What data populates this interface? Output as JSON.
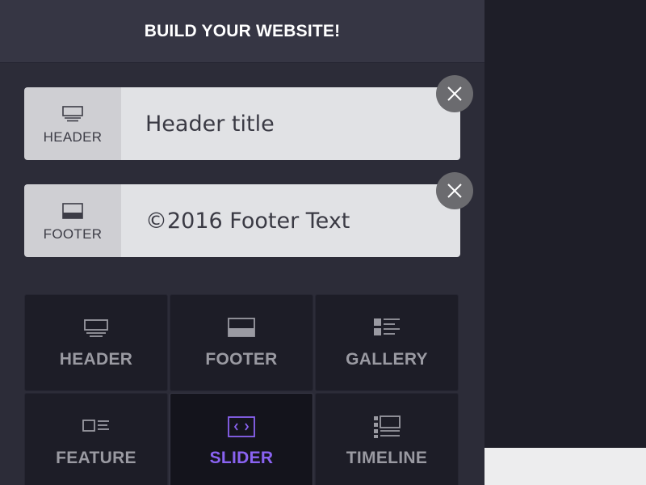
{
  "panel": {
    "title": "BUILD YOUR WEBSITE!"
  },
  "blocks": [
    {
      "tag": "HEADER",
      "icon": "header-icon",
      "value": "Header title"
    },
    {
      "tag": "FOOTER",
      "icon": "footer-icon",
      "value": "©2016 Footer Text"
    }
  ],
  "remove_icon": "close-icon",
  "tiles": [
    {
      "label": "HEADER",
      "icon": "header-icon",
      "active": false
    },
    {
      "label": "FOOTER",
      "icon": "footer-icon",
      "active": false
    },
    {
      "label": "GALLERY",
      "icon": "gallery-icon",
      "active": false
    },
    {
      "label": "FEATURE",
      "icon": "feature-icon",
      "active": false
    },
    {
      "label": "SLIDER",
      "icon": "slider-icon",
      "active": true
    },
    {
      "label": "TIMELINE",
      "icon": "timeline-icon",
      "active": false
    }
  ],
  "colors": {
    "accent": "#8a63f2",
    "panel_bg": "#2c2c38",
    "tile_text": "#9a9aa2"
  }
}
